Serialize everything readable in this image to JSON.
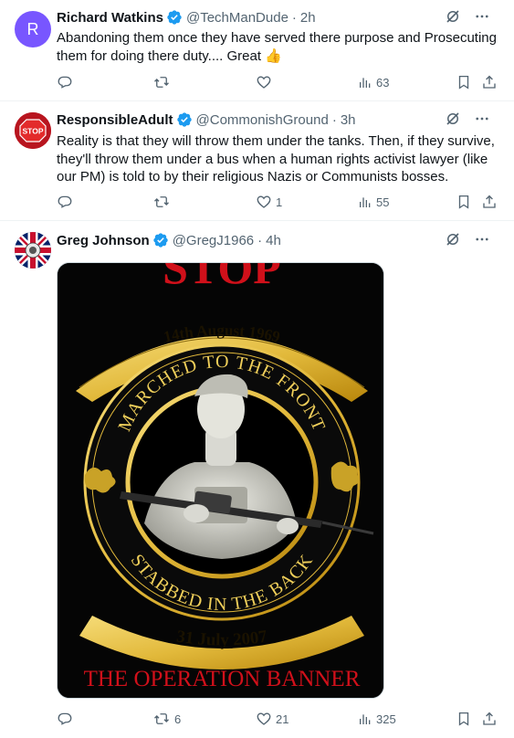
{
  "colors": {
    "accent": "#1d9bf0",
    "muted": "#536471",
    "text": "#0f1419",
    "gold": "#e2b93b",
    "red": "#d0101a"
  },
  "tweets": [
    {
      "name": "Richard Watkins",
      "handle": "@TechManDude",
      "time": "2h",
      "avatar_letter": "R",
      "text": "Abandoning them once they have served there purpose and Prosecuting them for doing there duty.... Great 👍",
      "replies": "",
      "reposts": "",
      "likes": "",
      "views": "63"
    },
    {
      "name": "ResponsibleAdult",
      "handle": "@CommonishGround",
      "time": "3h",
      "avatar_label": "STOP",
      "text": "Reality is that they will throw them under the tanks. Then, if they survive, they'll throw them under a  bus when a human rights activist lawyer (like our PM) is told to by their religious Nazis or Communists bosses.",
      "replies": "",
      "reposts": "",
      "likes": "1",
      "views": "55"
    },
    {
      "name": "Greg Johnson",
      "handle": "@GregJ1966",
      "time": "4h",
      "image": {
        "top_text": "STOP",
        "date_top": "14th August 1969",
        "ring_top": "MARCHED TO THE FRONT",
        "ring_bottom": "STABBED IN THE BACK",
        "date_bottom": "31 July 2007",
        "bottom_text": "THE OPERATION BANNER"
      },
      "replies": "",
      "reposts": "6",
      "likes": "21",
      "views": "325"
    }
  ]
}
